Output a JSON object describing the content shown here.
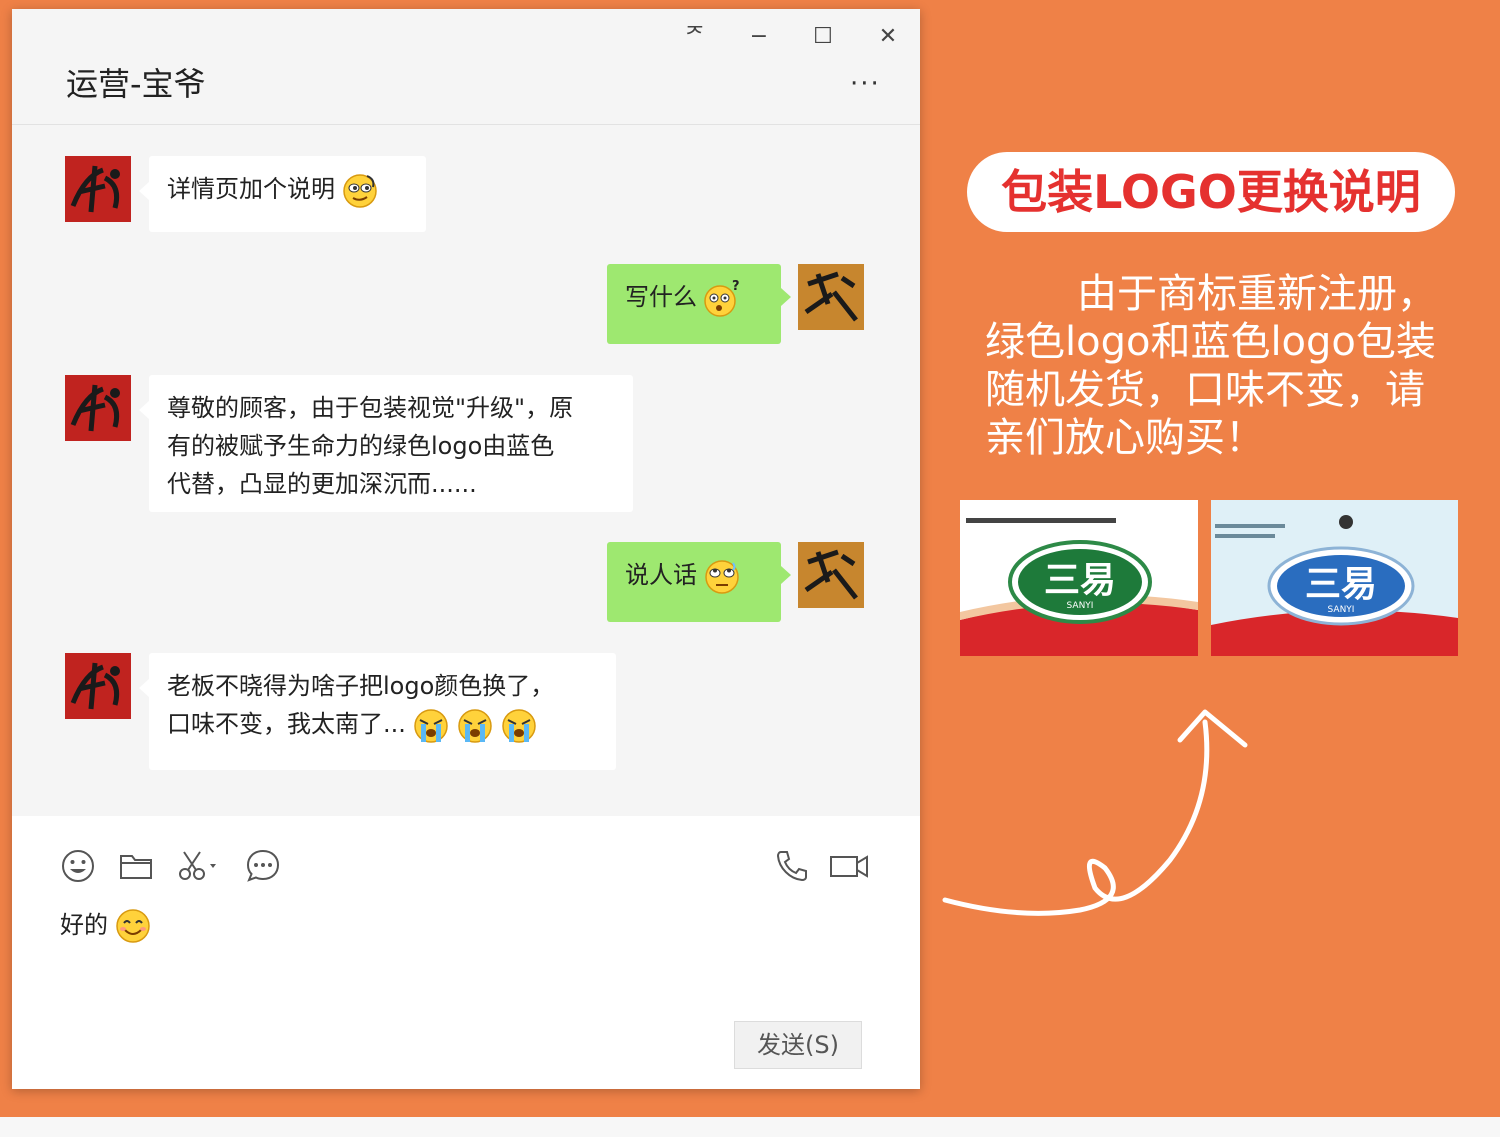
{
  "window": {
    "title": "运营-宝爷",
    "controls": {
      "pin": "ᅎ",
      "minimize": "−",
      "maximize": "☐",
      "close": "✕"
    },
    "more": "···"
  },
  "messages": [
    {
      "side": "left",
      "text": "详情页加个说明",
      "emoji": "smug-face"
    },
    {
      "side": "right",
      "text": "写什么",
      "emoji": "confused-face"
    },
    {
      "side": "left",
      "lines": [
        "尊敬的顾客，由于包装视觉\"升级\"，原",
        "有的被赋予生命力的绿色logo由蓝色",
        "代替，凸显的更加深沉而......"
      ]
    },
    {
      "side": "right",
      "text": "说人话",
      "emoji": "eye-roll-face"
    },
    {
      "side": "left",
      "lines": [
        "老板不晓得为啥子把logo颜色换了，",
        "口味不变，我太南了..."
      ],
      "emoji": "crying-face"
    }
  ],
  "toolbar": {
    "icons": [
      "emoji-icon",
      "folder-icon",
      "scissors-icon",
      "chat-history-icon",
      "phone-icon",
      "video-icon"
    ]
  },
  "input": {
    "draft": "好的",
    "emoji": "smile-face"
  },
  "send_button": "发送(S)",
  "panel": {
    "headline": "包装LOGO更换说明",
    "notice": "由于商标重新注册，绿色logo和蓝色logo包装随机发货，口味不变，请亲们放心购买！",
    "brand": "三易",
    "brand_en": "SANYI",
    "colors": {
      "old_logo": "#1e7a3a",
      "new_logo": "#2a6dbf",
      "accent": "#e5312f",
      "background": "#ef8147"
    }
  }
}
